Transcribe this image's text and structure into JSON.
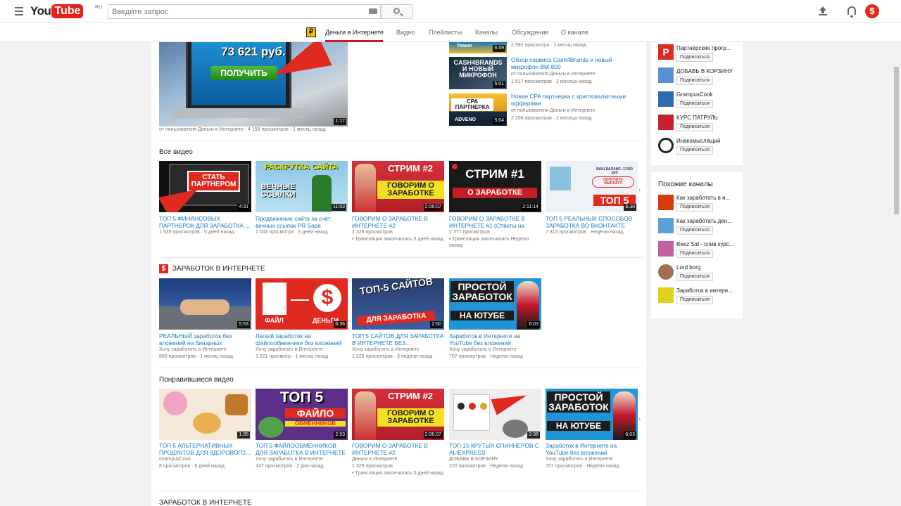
{
  "header": {
    "logo_you": "You",
    "logo_tube": "Tube",
    "logo_region": "RU",
    "search_placeholder": "Введите запрос"
  },
  "channel_nav": {
    "tabs": [
      {
        "label": "Деньги в Интернете",
        "active": true
      },
      {
        "label": "Видео"
      },
      {
        "label": "Плейлисты"
      },
      {
        "label": "Каналы"
      },
      {
        "label": "Обсуждение"
      },
      {
        "label": "О канале"
      }
    ]
  },
  "featured": {
    "thumb_amount": "73 621 руб.",
    "thumb_button": "ПОЛУЧИТЬ",
    "duration": "1:17",
    "meta": [
      "от пользователя Деньги в Интернете",
      "4 158 просмотров",
      "1 месяц назад"
    ]
  },
  "featured_list": [
    {
      "duration": "6:59",
      "views": "2 592 просмотра",
      "age": "1 месяц назад",
      "thumb_text": "Teaser"
    },
    {
      "title": "Обзор сервиса Cash4Brands и новый микрофон BM-800",
      "author": "от пользователя Деньги в Интернете",
      "views": "1 517 просмотров",
      "age": "2 месяца назад",
      "duration": "5:01",
      "thumb_text": "CASH4BRANDS И НОВЫЙ МИКРОФОН"
    },
    {
      "title": "Новая CPA партнерка с криптовалютными офферами",
      "author": "от пользователя Деньги в Интернете",
      "views": "2 206 просмотров",
      "age": "2 месяца назад",
      "duration": "5:04",
      "thumb_text": "CPA ПАРТНЕРКА",
      "thumb_sub": "ADVENO"
    }
  ],
  "sections": [
    {
      "title": "Все видео",
      "items": [
        {
          "title": "ТОП 5 ФИНАНСОВЫХ ПАРТНЕРОК ДЛЯ ЗАРАБОТКА ...",
          "meta": [
            "1 535 просмотров",
            "5 дней назад"
          ],
          "duration": "4:31",
          "thumb_text": "СТАТЬ ПАРТНЕРОМ"
        },
        {
          "title": "Продвижение сайта за счет вечных ссылок PR Sape",
          "meta": [
            "1 043 просмотра",
            "5 дней назад"
          ],
          "duration": "11:03",
          "thumb_text": "РАСКРУТКА САЙТА",
          "thumb_sub": "ВЕЧНЫЕ ССЫЛКИ"
        },
        {
          "title": "ГОВОРИМ О ЗАРАБОТКЕ В ИНТЕРНЕТЕ #2",
          "meta": [
            "1 329 просмотров"
          ],
          "note": "Трансляция закончилась 5 дней назад",
          "duration": "2:06:07",
          "thumb_text": "СТРИМ #2",
          "thumb_sub": "ГОВОРИМ О ЗАРАБОТКЕ"
        },
        {
          "title": "ГОВОРИМ О ЗАРАБОТКЕ В ИНТЕРНЕТЕ #1 (Ответы на",
          "meta": [
            "2 377 просмотров"
          ],
          "note": "Трансляция закончилась Неделю назад",
          "duration": "2:11:14",
          "thumb_text": "СТРИМ #1",
          "thumb_sub": "О ЗАРАБОТКЕ"
        },
        {
          "title": "ТОП 5 РЕАЛЬНЫХ СПОСОБОВ ЗАРАБОТКА ВО ВКОНТАКТЕ",
          "meta": [
            "7 813 просмотров",
            "Неделю назад"
          ],
          "duration": "6:30",
          "thumb_text": "ТОП 5",
          "thumb_sub": "ВАШ БАЛАНС: 17430 руб",
          "thumb_btn": "ПОЛУЧИТЬ ВЫПЛАТУ"
        }
      ]
    },
    {
      "title": "ЗАРАБОТОК В ИНТЕРНЕТЕ",
      "icon": "$",
      "items": [
        {
          "title": "РЕАЛЬНЫЙ заработок без вложений на бинарных",
          "author": "Хочу заработать в Интернете",
          "meta": [
            "800 просмотров",
            "1 месяц назад"
          ],
          "duration": "5:53"
        },
        {
          "title": "Легкий заработок на файлообменнике без вложений",
          "author": "Хочу заработать в Интернете",
          "meta": [
            "1 221 просмотр",
            "1 месяц назад"
          ],
          "duration": "6:36",
          "thumb_text": "ФАЙЛ",
          "thumb_sub": "ДЕНЬГИ",
          "thumb_symbol": "$"
        },
        {
          "title": "ТОП 5 САЙТОВ ДЛЯ ЗАРАБОТКА В ИНТЕРНЕТЕ БЕЗ...",
          "author": "Хочу заработать в Интернете",
          "meta": [
            "1 225 просмотров",
            "3 недели назад"
          ],
          "duration": "2:50",
          "thumb_text": "ТОП-5 САЙТОВ",
          "thumb_sub": "ДЛЯ ЗАРАБОТКА"
        },
        {
          "title": "Заработок в Интернете на YouTube без вложений",
          "author": "Хочу заработать в Интернете",
          "meta": [
            "707 просмотров",
            "Неделю назад"
          ],
          "duration": "6:03",
          "thumb_text": "ПРОСТОЙ ЗАРАБОТОК",
          "thumb_sub": "НА ЮТУБЕ"
        }
      ]
    },
    {
      "title": "Понравившиеся видео",
      "items": [
        {
          "title": "ТОП 5 АЛЬТЕРНАТИВНЫХ ПРОДУКТОВ ДЛЯ ЗДОРОВОГО...",
          "author": "GrampusCook",
          "meta": [
            "8 просмотров",
            "6 дней назад"
          ],
          "duration": "1:35"
        },
        {
          "title": "ТОП 5 ФАЙЛООБМЕННИКОВ ДЛЯ ЗАРАБОТКА В ИНТЕРНЕТЕ",
          "author": "Хочу заработать в Интернете",
          "meta": [
            "147 просмотров",
            "2 дня назад"
          ],
          "duration": "2:53",
          "thumb_text": "ТОП 5",
          "thumb_sub": "ФАЙЛО",
          "thumb_sub2": "ОБМЕННИКОВ"
        },
        {
          "title": "ГОВОРИМ О ЗАРАБОТКЕ В ИНТЕРНЕТЕ #2",
          "author": "Деньги в Интернете",
          "meta": [
            "1 329 просмотров"
          ],
          "note": "Трансляция закончилась 5 дней назад",
          "duration": "2:06:07",
          "thumb_text": "СТРИМ #2",
          "thumb_sub": "ГОВОРИМ О ЗАРАБОТКЕ"
        },
        {
          "title": "ТОП 15 КРУТЫХ СПИННЕРОВ С ALIEXPRESS",
          "author": "ДОБАВЬ В КОРЗИНУ",
          "meta": [
            "220 просмотров",
            "Неделю назад"
          ],
          "duration": "2:38"
        },
        {
          "title": "Заработок в Интернете на YouTube без вложений",
          "author": "Хочу заработать в Интернете",
          "meta": [
            "707 просмотров",
            "Неделю назад"
          ],
          "duration": "6:03",
          "thumb_text": "ПРОСТОЙ ЗАРАБОТОК",
          "thumb_sub": "НА ЮТУБЕ"
        }
      ]
    },
    {
      "title": "ЗАРАБОТОК В ИНТЕРНЕТЕ"
    }
  ],
  "sidebar": {
    "subscribe_label": "Подписаться",
    "featured_channels": [
      {
        "name": "Партнёрские прогр...",
        "color": "#e02a20"
      },
      {
        "name": "ДОБАВЬ В КОРЗИНУ",
        "color": "#5a8fd8"
      },
      {
        "name": "GrampusCook",
        "color": "#2a6db5"
      },
      {
        "name": "КУРС ПАТРУЛЬ",
        "color": "#c82030"
      },
      {
        "name": "Инакомыслящий",
        "color": "#222222"
      }
    ],
    "related_title": "Похожие каналы",
    "related_channels": [
      {
        "name": "Как заработать в и...",
        "color": "#d83a10"
      },
      {
        "name": "Как заработать ден...",
        "color": "#5aa0d8"
      },
      {
        "name": "Beez Sid - слив курс...",
        "color": "#c060a0"
      },
      {
        "name": "Lord borg",
        "color": "#a07050"
      },
      {
        "name": "Заработок в интерн...",
        "color": "#e0d020"
      }
    ]
  },
  "colors": {
    "accent": "#cc181e",
    "link": "#167ac6",
    "brand_red": "#e62117"
  }
}
